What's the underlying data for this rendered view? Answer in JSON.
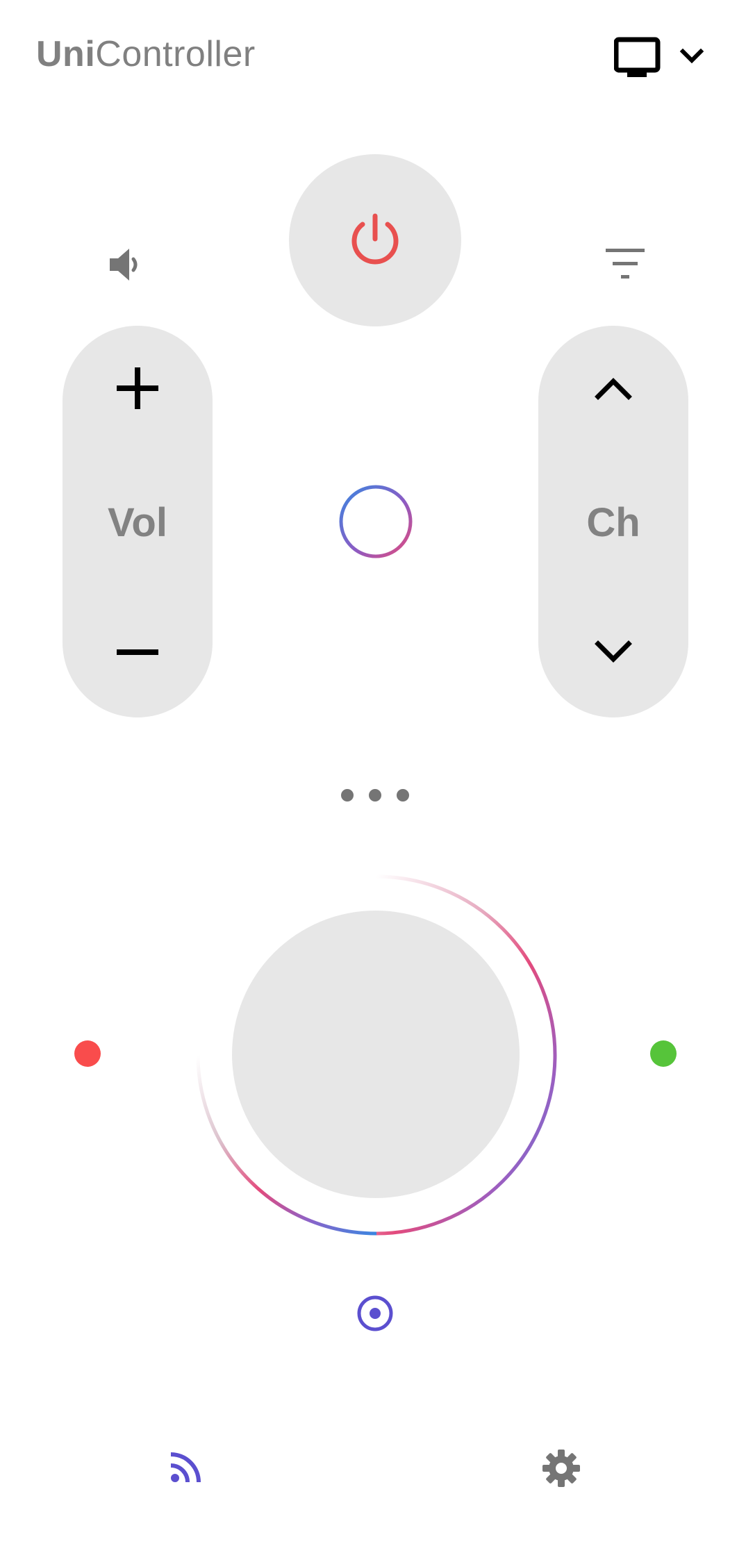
{
  "header": {
    "title_bold": "Uni",
    "title_light": "Controller",
    "device_icon": "tv-icon",
    "dropdown_icon": "chevron-down-icon"
  },
  "remote": {
    "power_icon": "power-icon",
    "mute_icon": "volume-icon",
    "filter_icon": "filter-icon",
    "volume": {
      "label": "Vol",
      "up_icon": "plus-icon",
      "down_icon": "minus-icon"
    },
    "channel": {
      "label": "Ch",
      "up_icon": "chevron-up-icon",
      "down_icon": "chevron-down-icon"
    },
    "home_icon": "gradient-ring-icon",
    "more_icon": "more-dots-icon",
    "dpad_ok_icon": "dpad-ok-button",
    "color_buttons": {
      "red": "#f94c4c",
      "green": "#56c43a"
    },
    "source_icon": "target-icon"
  },
  "bottom_bar": {
    "cast_icon": "cast-icon",
    "settings_icon": "gear-icon"
  },
  "colors": {
    "accent_purple": "#5b4fcf",
    "power_red": "#e8504f",
    "pill_gray": "#e7e7e7",
    "label_gray": "#828282",
    "gradient_blue": "#3b86e0",
    "gradient_pink": "#e34b7d"
  }
}
